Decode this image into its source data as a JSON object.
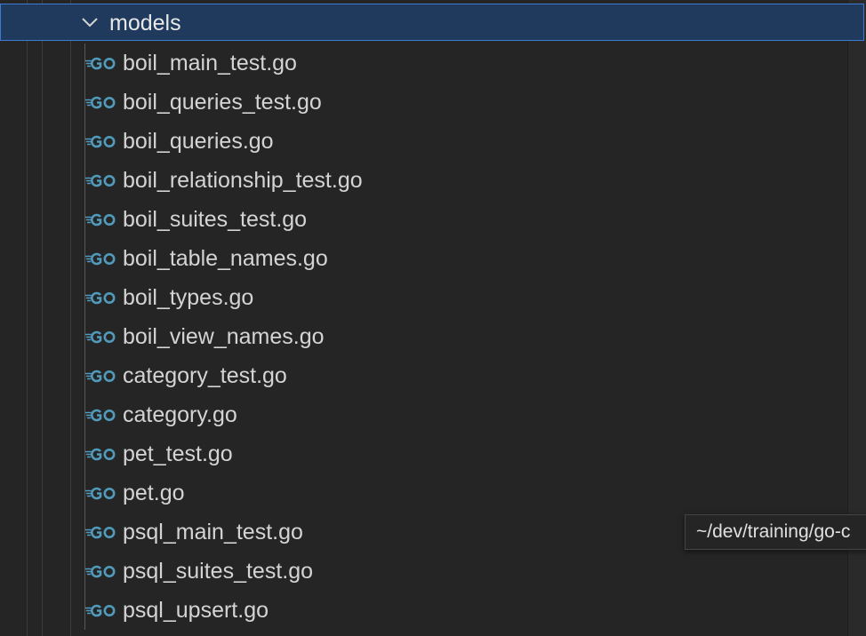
{
  "explorer": {
    "folder": {
      "name": "models",
      "expanded": true,
      "icon": "chevron-down-icon"
    },
    "file_icon": "go-file-icon",
    "files": [
      {
        "name": "boil_main_test.go"
      },
      {
        "name": "boil_queries_test.go"
      },
      {
        "name": "boil_queries.go"
      },
      {
        "name": "boil_relationship_test.go"
      },
      {
        "name": "boil_suites_test.go"
      },
      {
        "name": "boil_table_names.go"
      },
      {
        "name": "boil_types.go"
      },
      {
        "name": "boil_view_names.go"
      },
      {
        "name": "category_test.go"
      },
      {
        "name": "category.go"
      },
      {
        "name": "pet_test.go"
      },
      {
        "name": "pet.go"
      },
      {
        "name": "psql_main_test.go"
      },
      {
        "name": "psql_suites_test.go"
      },
      {
        "name": "psql_upsert.go"
      }
    ]
  },
  "tooltip": {
    "text": "~/dev/training/go-c"
  },
  "colors": {
    "background": "#252526",
    "selection_background": "#1f3a5c",
    "selection_border": "#3d7ad1",
    "go_icon": "#519aba",
    "text": "#d4d4d4"
  }
}
